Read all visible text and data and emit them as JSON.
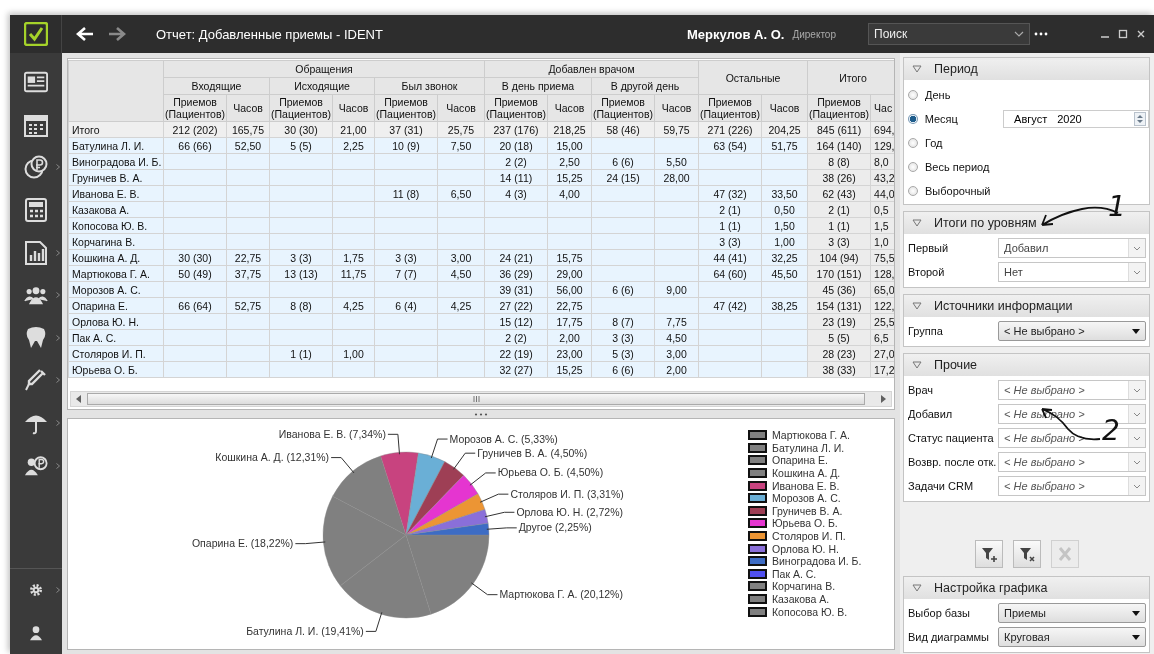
{
  "window": {
    "title": "Отчет: Добавленные приемы - IDENT",
    "user": "Меркулов А. О.",
    "role": "Директор",
    "search": {
      "placeholder": "Поиск"
    }
  },
  "sidebar": {
    "items": [
      {
        "kind": "card",
        "submenu": false
      },
      {
        "kind": "calendar",
        "submenu": false
      },
      {
        "kind": "coin",
        "submenu": true
      },
      {
        "kind": "calculator",
        "submenu": false
      },
      {
        "kind": "report",
        "submenu": true
      },
      {
        "kind": "people",
        "submenu": true
      },
      {
        "kind": "tooth",
        "submenu": true
      },
      {
        "kind": "syringe",
        "submenu": true
      },
      {
        "kind": "umbrella",
        "submenu": true
      },
      {
        "kind": "person-coin",
        "submenu": true
      }
    ],
    "bottom_items": [
      {
        "kind": "gear",
        "submenu": true
      },
      {
        "kind": "user",
        "submenu": false
      }
    ]
  },
  "table": {
    "groups": [
      {
        "label": "Обращения",
        "subgroups": [
          "Входящие",
          "Исходящие",
          "Был звонок"
        ]
      },
      {
        "label": "Добавлен врачом",
        "subgroups": [
          "В день приема",
          "В другой день"
        ]
      },
      {
        "label": "Остальные"
      },
      {
        "label": "Итого"
      }
    ],
    "columns": [
      "Приемов (Пациентов)",
      "Часов",
      "Приемов (Пациентов)",
      "Часов",
      "Приемов (Пациентов)",
      "Часов",
      "Приемов (Пациентов)",
      "Часов",
      "Приемов (Пациентов)",
      "Часов",
      "Приемов (Пациентов)",
      "Часов",
      "Приемов (Пациентов)",
      "Час"
    ],
    "rows": [
      {
        "kind": "total",
        "name": "Итого",
        "cells": [
          "212 (202)",
          "165,75",
          "30 (30)",
          "21,00",
          "37 (31)",
          "25,75",
          "237 (176)",
          "218,25",
          "58 (46)",
          "59,75",
          "271 (226)",
          "204,25",
          "845 (611)",
          "694,"
        ]
      },
      {
        "kind": "data",
        "name": "Батулина Л. И.",
        "cells": [
          "66 (66)",
          "52,50",
          "5 (5)",
          "2,25",
          "10 (9)",
          "7,50",
          "20 (18)",
          "15,00",
          null,
          null,
          "63 (54)",
          "51,75",
          "164 (140)",
          "129,"
        ]
      },
      {
        "kind": "data",
        "name": "Виноградова И. Б.",
        "cells": [
          null,
          null,
          null,
          null,
          null,
          null,
          "2 (2)",
          "2,50",
          "6 (6)",
          "5,50",
          null,
          null,
          "8 (8)",
          "8,0"
        ]
      },
      {
        "kind": "data",
        "name": "Груничев В. А.",
        "cells": [
          null,
          null,
          null,
          null,
          null,
          null,
          "14 (11)",
          "15,25",
          "24 (15)",
          "28,00",
          null,
          null,
          "38 (26)",
          "43,2"
        ]
      },
      {
        "kind": "data",
        "name": "Иванова Е. В.",
        "cells": [
          null,
          null,
          null,
          null,
          "11 (8)",
          "6,50",
          "4 (3)",
          "4,00",
          null,
          null,
          "47 (32)",
          "33,50",
          "62 (43)",
          "44,0"
        ]
      },
      {
        "kind": "data",
        "name": "Казакова А.",
        "cells": [
          null,
          null,
          null,
          null,
          null,
          null,
          null,
          null,
          null,
          null,
          "2 (1)",
          "0,50",
          "2 (1)",
          "0,5"
        ]
      },
      {
        "kind": "data",
        "name": "Копосова Ю. В.",
        "cells": [
          null,
          null,
          null,
          null,
          null,
          null,
          null,
          null,
          null,
          null,
          "1 (1)",
          "1,50",
          "1 (1)",
          "1,5"
        ]
      },
      {
        "kind": "data",
        "name": "Корчагина В.",
        "cells": [
          null,
          null,
          null,
          null,
          null,
          null,
          null,
          null,
          null,
          null,
          "3 (3)",
          "1,00",
          "3 (3)",
          "1,0"
        ]
      },
      {
        "kind": "data",
        "name": "Кошкина А. Д.",
        "cells": [
          "30 (30)",
          "22,75",
          "3 (3)",
          "1,75",
          "3 (3)",
          "3,00",
          "24 (21)",
          "15,75",
          null,
          null,
          "44 (41)",
          "32,25",
          "104 (94)",
          "75,5"
        ]
      },
      {
        "kind": "data",
        "name": "Мартюкова Г. А.",
        "cells": [
          "50 (49)",
          "37,75",
          "13 (13)",
          "11,75",
          "7 (7)",
          "4,50",
          "36 (29)",
          "29,00",
          null,
          null,
          "64 (60)",
          "45,50",
          "170 (151)",
          "128,"
        ]
      },
      {
        "kind": "data",
        "name": "Морозов А. С.",
        "cells": [
          null,
          null,
          null,
          null,
          null,
          null,
          "39 (31)",
          "56,00",
          "6 (6)",
          "9,00",
          null,
          null,
          "45 (36)",
          "65,0"
        ]
      },
      {
        "kind": "data",
        "name": "Опарина Е.",
        "cells": [
          "66 (64)",
          "52,75",
          "8 (8)",
          "4,25",
          "6 (4)",
          "4,25",
          "27 (22)",
          "22,75",
          null,
          null,
          "47 (42)",
          "38,25",
          "154 (131)",
          "122,"
        ]
      },
      {
        "kind": "data",
        "name": "Орлова Ю. Н.",
        "cells": [
          null,
          null,
          null,
          null,
          null,
          null,
          "15 (12)",
          "17,75",
          "8 (7)",
          "7,75",
          null,
          null,
          "23 (19)",
          "25,5"
        ]
      },
      {
        "kind": "data",
        "name": "Пак А. С.",
        "cells": [
          null,
          null,
          null,
          null,
          null,
          null,
          "2 (2)",
          "2,00",
          "3 (3)",
          "4,50",
          null,
          null,
          "5 (5)",
          "6,5"
        ]
      },
      {
        "kind": "data",
        "name": "Столяров И. П.",
        "cells": [
          null,
          null,
          "1 (1)",
          "1,00",
          null,
          null,
          "22 (19)",
          "23,00",
          "5 (3)",
          "3,00",
          null,
          null,
          "28 (23)",
          "27,0"
        ]
      },
      {
        "kind": "data",
        "name": "Юрьева О. Б.",
        "cells": [
          null,
          null,
          null,
          null,
          null,
          null,
          "32 (27)",
          "15,25",
          "6 (6)",
          "2,00",
          null,
          null,
          "38 (33)",
          "17,2"
        ]
      }
    ]
  },
  "chart": {
    "chart_data": {
      "type": "pie",
      "categories": [
        "Мартюкова Г. А. (20,12%)",
        "Батулина Л. И. (19,41%)",
        "Опарина Е. (18,22%)",
        "Кошкина А. Д. (12,31%)",
        "Иванова Е. В. (7,34%)",
        "Морозов А. С. (5,33%)",
        "Груничев В. А. (4,50%)",
        "Юрьева О. Б. (4,50%)",
        "Столяров И. П. (3,31%)",
        "Орлова Ю. Н. (2,72%)",
        "Другое (2,25%)"
      ],
      "values": [
        20.12,
        19.41,
        18.22,
        12.31,
        7.34,
        5.33,
        4.5,
        4.5,
        3.31,
        2.72,
        2.25
      ],
      "colors": [
        "#808080",
        "#808080",
        "#808080",
        "#808080",
        "#c8437f",
        "#6aafd6",
        "#9e3f55",
        "#e535d0",
        "#ec9534",
        "#8a6fd9",
        "#3d6cc4"
      ]
    },
    "legend": [
      {
        "name": "Мартюкова Г. А.",
        "color": "#808080"
      },
      {
        "name": "Батулина Л. И.",
        "color": "#808080"
      },
      {
        "name": "Опарина Е.",
        "color": "#808080"
      },
      {
        "name": "Кошкина А. Д.",
        "color": "#808080"
      },
      {
        "name": "Иванова Е. В.",
        "color": "#c8437f"
      },
      {
        "name": "Морозов А. С.",
        "color": "#6aafd6"
      },
      {
        "name": "Груничев В. А.",
        "color": "#9e3f55"
      },
      {
        "name": "Юрьева О. Б.",
        "color": "#e535d0"
      },
      {
        "name": "Столяров И. П.",
        "color": "#ec9534"
      },
      {
        "name": "Орлова Ю. Н.",
        "color": "#8a6fd9"
      },
      {
        "name": "Виноградова И. Б.",
        "color": "#3d6cc4"
      },
      {
        "name": "Пак А. С.",
        "color": "#5050f0"
      },
      {
        "name": "Корчагина В.",
        "color": "#808080"
      },
      {
        "name": "Казакова А.",
        "color": "#808080"
      },
      {
        "name": "Копосова Ю. В.",
        "color": "#808080"
      }
    ]
  },
  "filter_panel": [
    {
      "kind": "period",
      "title": "Период",
      "expanded": true,
      "options": [
        {
          "label": "День",
          "selected": false
        },
        {
          "label": "Месяц",
          "selected": true,
          "field": {
            "month": "Август",
            "year": "2020"
          }
        },
        {
          "label": "Год",
          "selected": false
        },
        {
          "label": "Весь период",
          "selected": false
        },
        {
          "label": "Выборочный",
          "selected": false
        }
      ]
    },
    {
      "kind": "fields",
      "title": "Итоги по уровням",
      "expanded": true,
      "fields": [
        {
          "kind": "combo",
          "label": "Первый",
          "value": "Добавил"
        },
        {
          "kind": "combo",
          "label": "Второй",
          "value": "Нет"
        }
      ]
    },
    {
      "kind": "fields",
      "title": "Источники информации",
      "expanded": true,
      "fields": [
        {
          "kind": "list",
          "label": "Группа",
          "value": "< Не выбрано >"
        }
      ]
    },
    {
      "kind": "fields",
      "title": "Прочие",
      "expanded": true,
      "fields": [
        {
          "kind": "combo",
          "label": "Врач",
          "placeholder": "< Не выбрано >"
        },
        {
          "kind": "combo",
          "label": "Добавил",
          "placeholder": "< Не выбрано >"
        },
        {
          "kind": "combo",
          "label": "Статус пациента",
          "placeholder": "< Не выбрано >"
        },
        {
          "kind": "combo",
          "label": "Возвр. после отк.",
          "placeholder": "< Не выбрано >"
        },
        {
          "kind": "combo",
          "label": "Задачи CRM",
          "placeholder": "< Не выбрано >"
        }
      ]
    },
    {
      "kind": "buttons",
      "buttons": [
        {
          "kind": "add-filter",
          "disabled": false
        },
        {
          "kind": "remove-filter",
          "disabled": false
        },
        {
          "kind": "reset",
          "disabled": true
        }
      ]
    },
    {
      "kind": "fields",
      "title": "Настройка графика",
      "expanded": true,
      "fields": [
        {
          "kind": "list",
          "label": "Выбор базы",
          "value": "Приемы"
        },
        {
          "kind": "list",
          "label": "Вид диаграммы",
          "value": "Круговая"
        }
      ]
    }
  ],
  "annotations": [
    {
      "label": "1"
    },
    {
      "label": "2"
    }
  ]
}
